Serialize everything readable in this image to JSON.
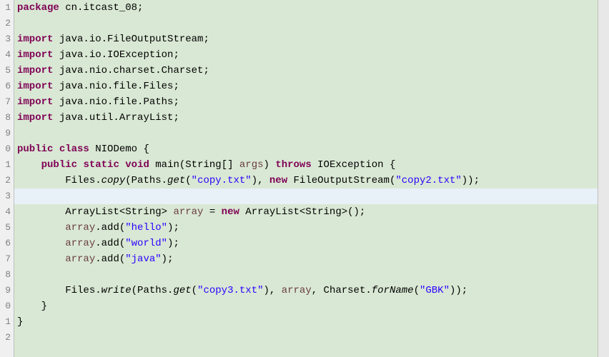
{
  "lines": [
    {
      "n": "1",
      "hl": false,
      "tokens": [
        {
          "c": "kw",
          "t": "package"
        },
        {
          "c": "plain",
          "t": " cn.itcast_08;"
        }
      ]
    },
    {
      "n": "2",
      "hl": false,
      "tokens": []
    },
    {
      "n": "3",
      "hl": false,
      "tokens": [
        {
          "c": "kw",
          "t": "import"
        },
        {
          "c": "plain",
          "t": " java.io.FileOutputStream;"
        }
      ]
    },
    {
      "n": "4",
      "hl": false,
      "tokens": [
        {
          "c": "kw",
          "t": "import"
        },
        {
          "c": "plain",
          "t": " java.io.IOException;"
        }
      ]
    },
    {
      "n": "5",
      "hl": false,
      "tokens": [
        {
          "c": "kw",
          "t": "import"
        },
        {
          "c": "plain",
          "t": " java.nio.charset.Charset;"
        }
      ]
    },
    {
      "n": "6",
      "hl": false,
      "tokens": [
        {
          "c": "kw",
          "t": "import"
        },
        {
          "c": "plain",
          "t": " java.nio.file.Files;"
        }
      ]
    },
    {
      "n": "7",
      "hl": false,
      "tokens": [
        {
          "c": "kw",
          "t": "import"
        },
        {
          "c": "plain",
          "t": " java.nio.file.Paths;"
        }
      ]
    },
    {
      "n": "8",
      "hl": false,
      "tokens": [
        {
          "c": "kw",
          "t": "import"
        },
        {
          "c": "plain",
          "t": " java.util.ArrayList;"
        }
      ]
    },
    {
      "n": "9",
      "hl": false,
      "tokens": []
    },
    {
      "n": "0",
      "hl": false,
      "tokens": [
        {
          "c": "kw",
          "t": "public"
        },
        {
          "c": "plain",
          "t": " "
        },
        {
          "c": "kw",
          "t": "class"
        },
        {
          "c": "plain",
          "t": " NIODemo {"
        }
      ]
    },
    {
      "n": "1",
      "hl": false,
      "tokens": [
        {
          "c": "plain",
          "t": "    "
        },
        {
          "c": "kw",
          "t": "public"
        },
        {
          "c": "plain",
          "t": " "
        },
        {
          "c": "kw",
          "t": "static"
        },
        {
          "c": "plain",
          "t": " "
        },
        {
          "c": "kw",
          "t": "void"
        },
        {
          "c": "plain",
          "t": " main(String[] "
        },
        {
          "c": "param",
          "t": "args"
        },
        {
          "c": "plain",
          "t": ") "
        },
        {
          "c": "kw",
          "t": "throws"
        },
        {
          "c": "plain",
          "t": " IOException {"
        }
      ]
    },
    {
      "n": "2",
      "hl": false,
      "tokens": [
        {
          "c": "plain",
          "t": "        Files."
        },
        {
          "c": "method",
          "t": "copy"
        },
        {
          "c": "plain",
          "t": "(Paths."
        },
        {
          "c": "method",
          "t": "get"
        },
        {
          "c": "plain",
          "t": "("
        },
        {
          "c": "str",
          "t": "\"copy.txt\""
        },
        {
          "c": "plain",
          "t": "), "
        },
        {
          "c": "kw",
          "t": "new"
        },
        {
          "c": "plain",
          "t": " FileOutputStream("
        },
        {
          "c": "str",
          "t": "\"copy2.txt\""
        },
        {
          "c": "plain",
          "t": "));"
        }
      ]
    },
    {
      "n": "3",
      "hl": true,
      "tokens": []
    },
    {
      "n": "4",
      "hl": false,
      "tokens": [
        {
          "c": "plain",
          "t": "        ArrayList<String> "
        },
        {
          "c": "param",
          "t": "array"
        },
        {
          "c": "plain",
          "t": " = "
        },
        {
          "c": "kw",
          "t": "new"
        },
        {
          "c": "plain",
          "t": " ArrayList<String>();"
        }
      ]
    },
    {
      "n": "5",
      "hl": false,
      "tokens": [
        {
          "c": "plain",
          "t": "        "
        },
        {
          "c": "param",
          "t": "array"
        },
        {
          "c": "plain",
          "t": ".add("
        },
        {
          "c": "str",
          "t": "\"hello\""
        },
        {
          "c": "plain",
          "t": ");"
        }
      ]
    },
    {
      "n": "6",
      "hl": false,
      "tokens": [
        {
          "c": "plain",
          "t": "        "
        },
        {
          "c": "param",
          "t": "array"
        },
        {
          "c": "plain",
          "t": ".add("
        },
        {
          "c": "str",
          "t": "\"world\""
        },
        {
          "c": "plain",
          "t": ");"
        }
      ]
    },
    {
      "n": "7",
      "hl": false,
      "tokens": [
        {
          "c": "plain",
          "t": "        "
        },
        {
          "c": "param",
          "t": "array"
        },
        {
          "c": "plain",
          "t": ".add("
        },
        {
          "c": "str",
          "t": "\"java\""
        },
        {
          "c": "plain",
          "t": ");"
        }
      ]
    },
    {
      "n": "8",
      "hl": false,
      "tokens": []
    },
    {
      "n": "9",
      "hl": false,
      "tokens": [
        {
          "c": "plain",
          "t": "        Files."
        },
        {
          "c": "method",
          "t": "write"
        },
        {
          "c": "plain",
          "t": "(Paths."
        },
        {
          "c": "method",
          "t": "get"
        },
        {
          "c": "plain",
          "t": "("
        },
        {
          "c": "str",
          "t": "\"copy3.txt\""
        },
        {
          "c": "plain",
          "t": "), "
        },
        {
          "c": "param",
          "t": "array"
        },
        {
          "c": "plain",
          "t": ", Charset."
        },
        {
          "c": "method",
          "t": "forName"
        },
        {
          "c": "plain",
          "t": "("
        },
        {
          "c": "str",
          "t": "\"GBK\""
        },
        {
          "c": "plain",
          "t": "));"
        }
      ]
    },
    {
      "n": "0",
      "hl": false,
      "tokens": [
        {
          "c": "plain",
          "t": "    }"
        }
      ]
    },
    {
      "n": "1",
      "hl": false,
      "tokens": [
        {
          "c": "plain",
          "t": "}"
        }
      ]
    },
    {
      "n": "2",
      "hl": false,
      "tokens": []
    }
  ]
}
